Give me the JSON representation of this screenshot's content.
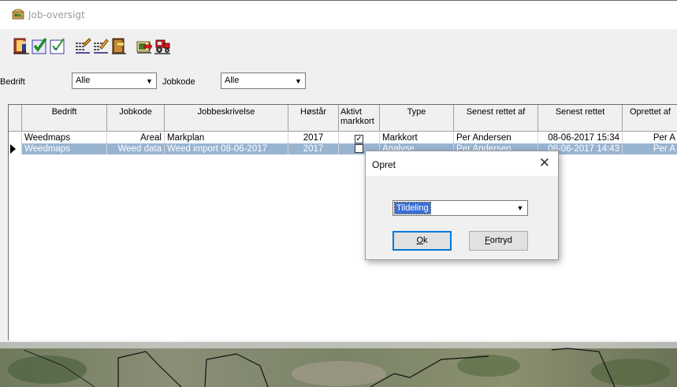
{
  "window": {
    "title": "Job-oversigt"
  },
  "toolbar": {
    "buttons": [
      {
        "icon": "person-exit-icon"
      },
      {
        "icon": "check-green-icon"
      },
      {
        "icon": "check-outline-icon"
      },
      {
        "icon": "grid-edit-icon"
      },
      {
        "icon": "grid-pencil-icon"
      },
      {
        "icon": "book-arrow-icon"
      },
      {
        "icon": "export-icon"
      },
      {
        "icon": "tractor-icon"
      }
    ]
  },
  "filters": {
    "bedrift_label": "Bedrift",
    "bedrift_value": "Alle",
    "jobkode_label": "Jobkode",
    "jobkode_value": "Alle"
  },
  "grid": {
    "headers": [
      "Bedrift",
      "Jobkode",
      "Jobbeskrivelse",
      "Høstår",
      "Aktivt markkort",
      "Type",
      "Senest rettet af",
      "Senest rettet",
      "Oprettet af"
    ],
    "rows": [
      [
        "Weedmaps",
        "Areal",
        "Markplan",
        "2017",
        "checked",
        "Markkort",
        "Per Andersen",
        "08-06-2017 15:34",
        "Per A"
      ],
      [
        "Weedmaps",
        "Weed data",
        "Weed import 08-06-2017",
        "2017",
        "unchecked",
        "Analyse",
        "Per Andersen",
        "08-06-2017 14:43",
        "Per A"
      ]
    ],
    "selected_row": 1
  },
  "dialog": {
    "title": "Opret",
    "close_glyph": "✕",
    "combo_value": "Tildeling",
    "ok_label_u": "O",
    "ok_label_rest": "k",
    "cancel_label_u": "F",
    "cancel_label_rest": "ortryd"
  },
  "colors": {
    "selection": "#99b4d1",
    "combo_highlight": "#3b6fd8"
  }
}
